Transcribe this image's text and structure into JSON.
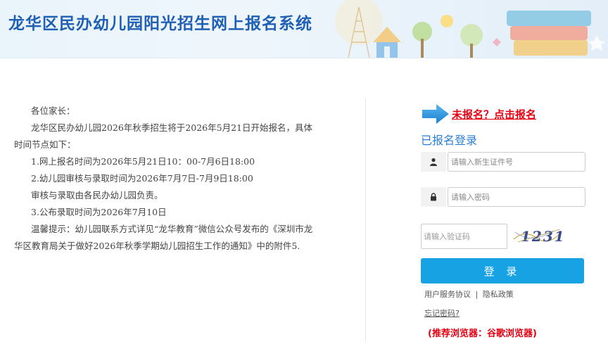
{
  "header": {
    "title": "龙华区民办幼儿园阳光招生网上报名系统"
  },
  "notice": {
    "greeting": "各位家长：",
    "intro": "龙华区民办幼儿园2026年秋季招生将于2026年5月21日开始报名，具体时间节点如下：",
    "items": [
      "1.网上报名时间为2026年5月21日10：00-7月6日18:00",
      "2.幼儿园审核与录取时间为2026年7月7日-7月9日18:00",
      "审核与录取由各民办幼儿园负责。",
      "3.公布录取时间为2026年7月10日"
    ],
    "tip": "温馨提示：幼儿园联系方式详见“龙华教育”微信公众号发布的《深圳市龙华区教育局关于做好2026年秋季学期幼儿园招生工作的通知》中的附件5."
  },
  "login": {
    "register_link": "未报名？点击报名",
    "title": "已报名登录",
    "id_placeholder": "请输入新生证件号",
    "password_placeholder": "请输入密码",
    "captcha_placeholder": "请输入验证码",
    "captcha_text": "1231",
    "submit_label": "登 录",
    "service_agreement": "用户服务协议",
    "separator": "|",
    "privacy_policy": "隐私政策",
    "forgot_password": "忘记密码?",
    "browser_tip": "(推荐浏览器：谷歌浏览器)"
  },
  "colors": {
    "title_blue": "#1f5fb4",
    "link_red": "#e60012",
    "button_blue": "#17a3e3",
    "login_title_blue": "#2a7fd4"
  },
  "icons": {
    "user": "user-icon",
    "lock": "lock-icon",
    "arrow": "arrow-right-icon"
  }
}
